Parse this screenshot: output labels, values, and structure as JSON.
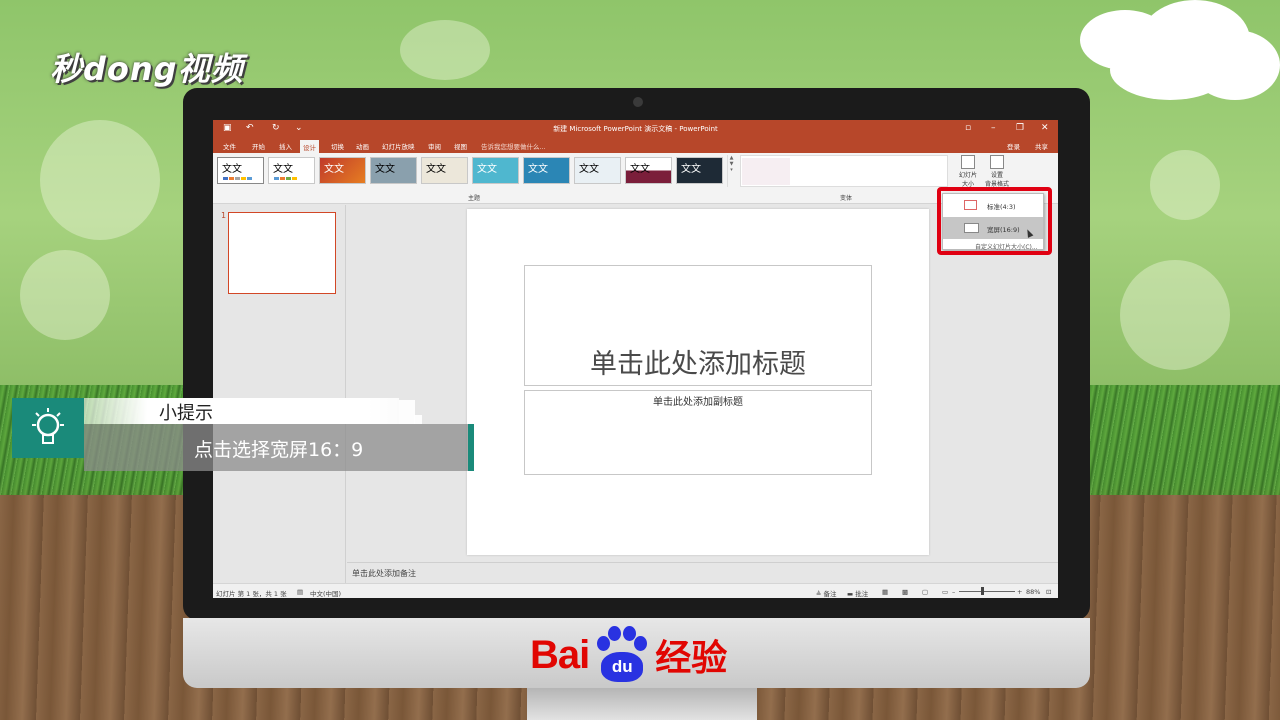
{
  "watermark": {
    "logo_text": "秒dong视频"
  },
  "window": {
    "title": "新建 Microsoft PowerPoint 演示文稿 - PowerPoint",
    "tabs": [
      "文件",
      "开始",
      "插入",
      "设计",
      "切换",
      "动画",
      "幻灯片放映",
      "审阅",
      "视图"
    ],
    "active_tab": "设计",
    "tell_me": "告诉我您想要做什么...",
    "sign_in": "登录",
    "share": "共享"
  },
  "ribbon": {
    "theme_sample_text": "文文",
    "group_themes": "主题",
    "group_variants": "变体",
    "slide_size_button": "幻灯片大小",
    "format_bg_button_line1": "设置",
    "format_bg_button_line2": "背景格式"
  },
  "slide_pane": {
    "slide_number": "1"
  },
  "slide": {
    "title_placeholder": "单击此处添加标题",
    "subtitle_placeholder": "单击此处添加副标题"
  },
  "notes": {
    "placeholder": "单击此处添加备注"
  },
  "status": {
    "slide_info": "幻灯片 第 1 张，共 1 张",
    "language": "中文(中国)",
    "notes_btn": "备注",
    "comments_btn": "批注",
    "zoom": "88%"
  },
  "dropdown": {
    "standard": "标准(4:3)",
    "widescreen": "宽屏(16:9)",
    "custom": "自定义幻灯片大小(C)..."
  },
  "tip": {
    "title": "小提示",
    "body": "点击选择宽屏16：9"
  },
  "brand": {
    "bai": "Bai",
    "du": "du",
    "jingyan": "经验"
  },
  "colors": {
    "accent": "#b7472a",
    "highlight": "#e00012",
    "tip_teal": "#1a8a7a",
    "baidu_red": "#e10602",
    "baidu_blue": "#2932e1"
  }
}
